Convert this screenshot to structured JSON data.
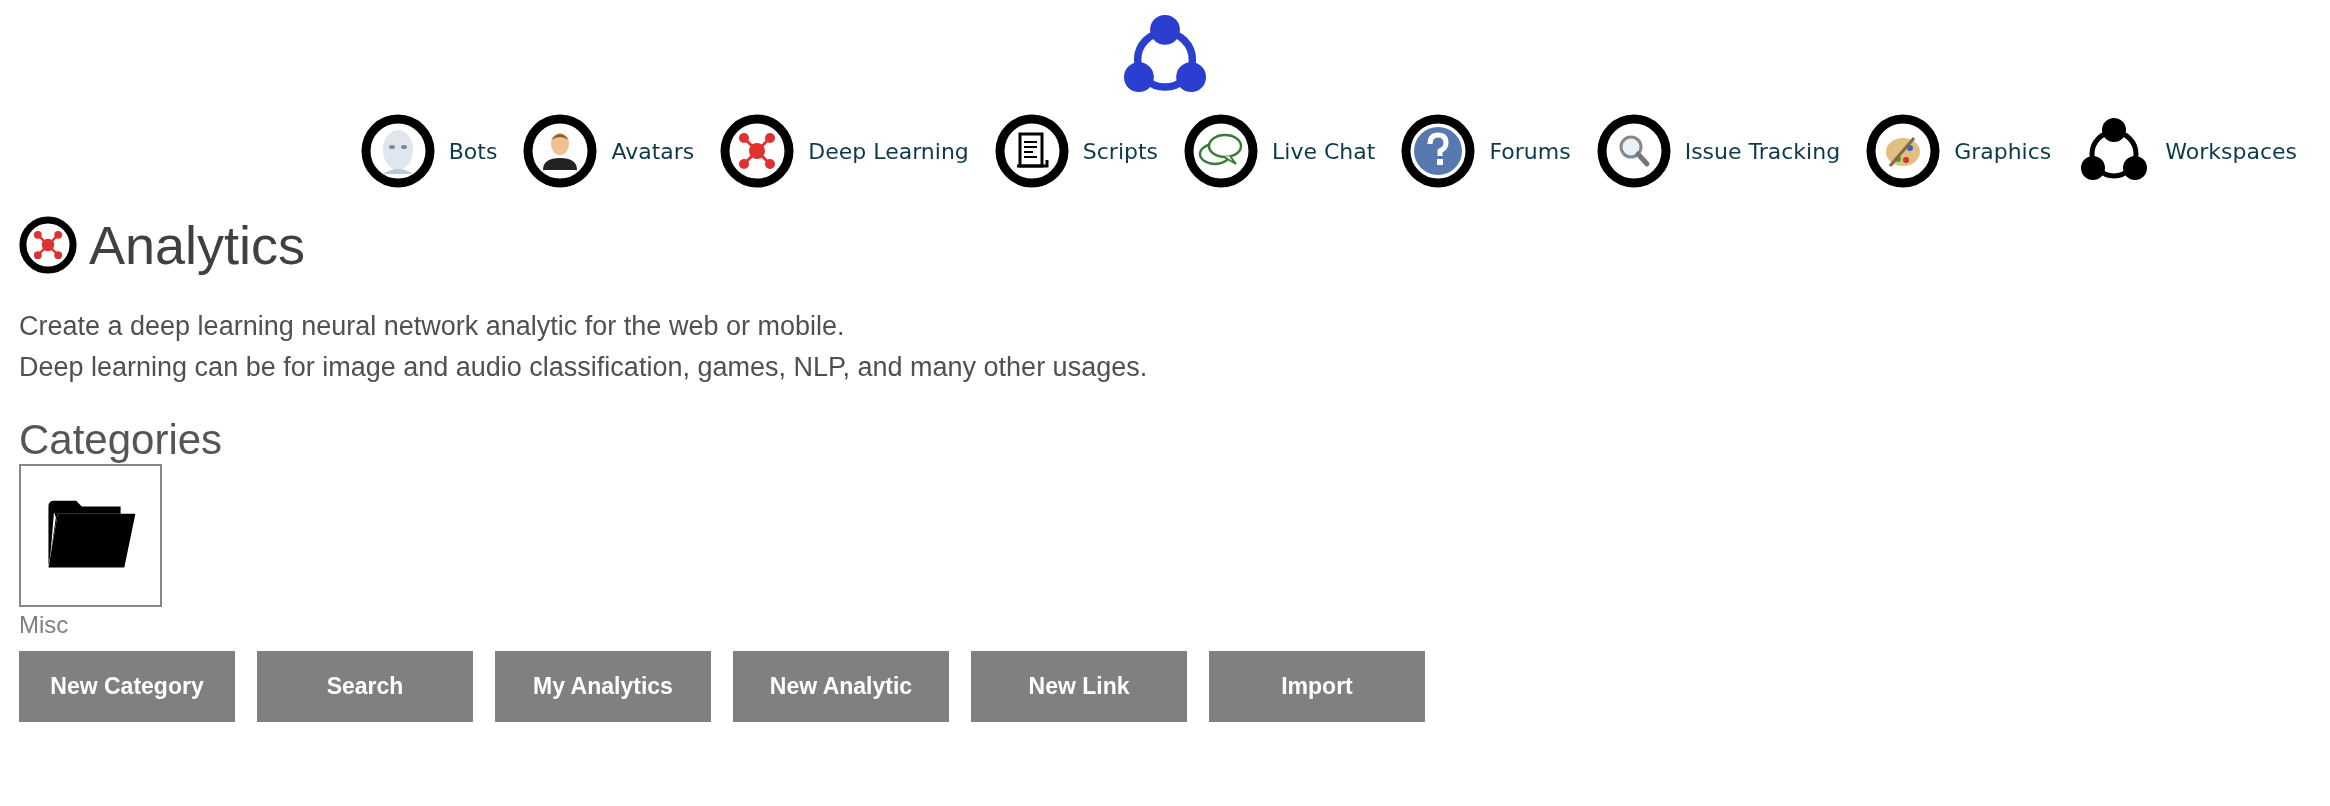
{
  "nav": [
    {
      "label": "Bots"
    },
    {
      "label": "Avatars"
    },
    {
      "label": "Deep Learning"
    },
    {
      "label": "Scripts"
    },
    {
      "label": "Live Chat"
    },
    {
      "label": "Forums"
    },
    {
      "label": "Issue Tracking"
    },
    {
      "label": "Graphics"
    },
    {
      "label": "Workspaces"
    }
  ],
  "page": {
    "title": "Analytics",
    "description": [
      "Create a deep learning neural network analytic for the web or mobile.",
      "Deep learning can be for image and audio classification, games, NLP, and many other usages."
    ]
  },
  "categories": {
    "heading": "Categories",
    "items": [
      {
        "label": "Misc"
      }
    ]
  },
  "buttons": [
    "New Category",
    "Search",
    "My Analytics",
    "New Analytic",
    "New Link",
    "Import"
  ]
}
